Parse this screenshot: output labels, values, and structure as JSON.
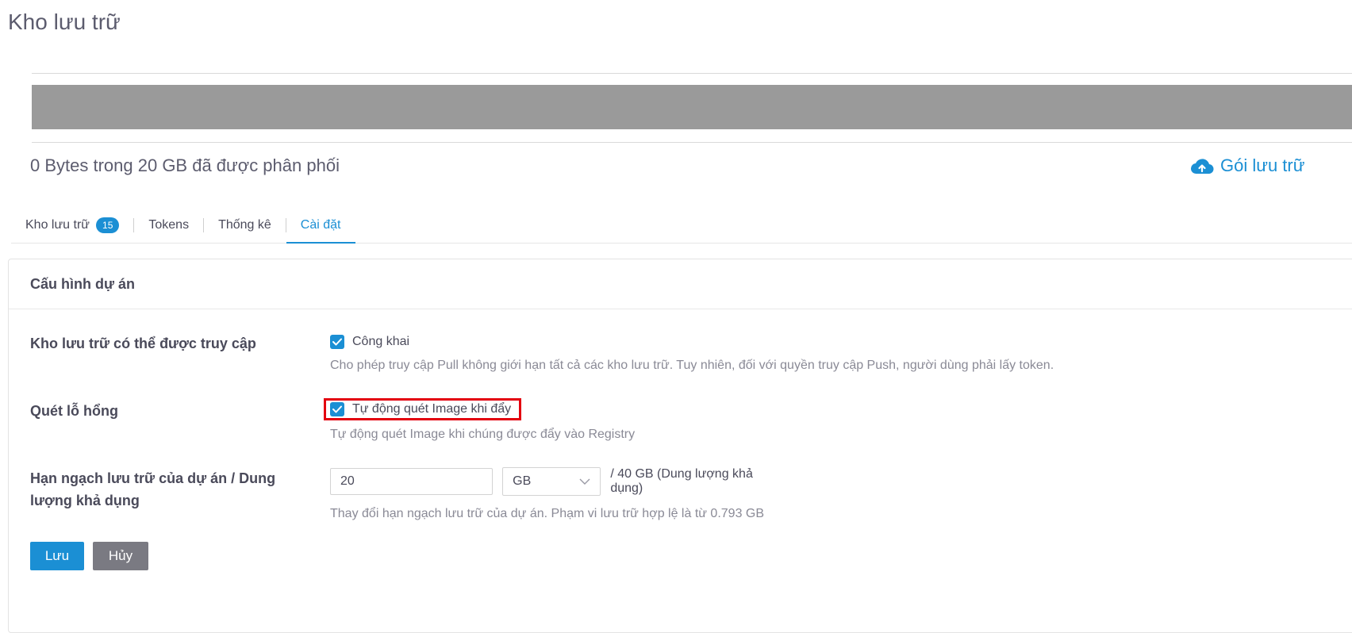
{
  "page": {
    "title": "Kho lưu trữ"
  },
  "usage": {
    "used_fraction": 0,
    "text": "0 Bytes trong 20 GB đã được phân phối",
    "storage_pack_label": "Gói lưu trữ",
    "bar_color": "#9a9a9a",
    "accent": "#1b8fd4"
  },
  "tabs": [
    {
      "label": "Kho lưu trữ",
      "badge": "15"
    },
    {
      "label": "Tokens"
    },
    {
      "label": "Thống kê"
    },
    {
      "label": "Cài đặt",
      "active": true
    }
  ],
  "panel": {
    "title": "Cấu hình dự án",
    "access": {
      "label": "Kho lưu trữ có thể được truy cập",
      "checkbox_label": "Công khai",
      "checked": true,
      "help": "Cho phép truy cập Pull không giới hạn tất cả các kho lưu trữ. Tuy nhiên, đối với quyền truy cập Push, người dùng phải lấy token."
    },
    "scan": {
      "label": "Quét lỗ hổng",
      "checkbox_label": "Tự động quét Image khi đẩy",
      "checked": true,
      "help": "Tự động quét Image khi chúng được đẩy vào Registry"
    },
    "quota": {
      "label": "Hạn ngạch lưu trữ của dự án / Dung lượng khả dụng",
      "value": "20",
      "unit": "GB",
      "suffix": "/ 40 GB (Dung lượng khả dụng)",
      "help": "Thay đổi hạn ngạch lưu trữ của dự án. Phạm vi lưu trữ hợp lệ là từ 0.793 GB"
    },
    "buttons": {
      "save": "Lưu",
      "cancel": "Hủy"
    }
  }
}
